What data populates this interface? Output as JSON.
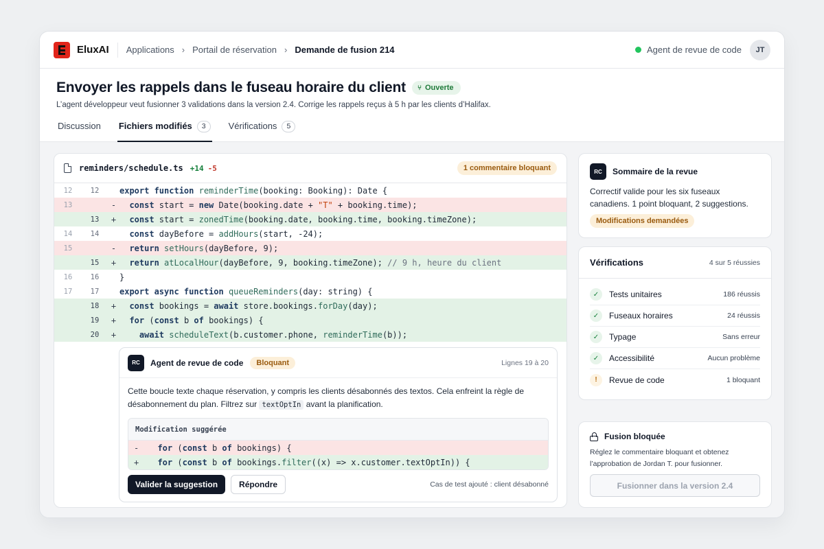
{
  "topbar": {
    "brand": "EluxAI",
    "breadcrumbs": [
      "Applications",
      "Portail de réservation",
      "Demande de fusion 214"
    ],
    "agent_status": "Agent de revue de code",
    "avatar_initials": "JT",
    "status_color": "#22c55e"
  },
  "header": {
    "title": "Envoyer les rappels dans le fuseau horaire du client",
    "status_badge": "Ouverte",
    "subtitle": "L’agent développeur veut fusionner 3 validations dans la version 2.4. Corrige les rappels reçus à 5 h par les clients d’Halifax.",
    "tabs": [
      {
        "label": "Discussion",
        "count": null
      },
      {
        "label": "Fichiers modifiés",
        "count": "3"
      },
      {
        "label": "Vérifications",
        "count": "5"
      }
    ]
  },
  "diff": {
    "filename": "reminders/schedule.ts",
    "additions": "+14",
    "deletions": "-5",
    "badge": "1 commentaire bloquant"
  },
  "comment": {
    "avatar": "RC",
    "author": "Agent de revue de code",
    "badge": "Bloquant",
    "lines": "Lignes 19 à 20",
    "body_1": "Cette boucle texte chaque réservation, y compris les clients désabonnés des textos. Cela enfreint la règle de désabonnement du plan. Filtrez sur ",
    "body_code": "textOptIn",
    "body_2": " avant la planification.",
    "suggestion_title": "Modification suggérée",
    "accept_label": "Valider la suggestion",
    "reply_label": "Répondre",
    "test_note": "Cas de test ajouté : client désabonné"
  },
  "summary": {
    "avatar": "RC",
    "title": "Sommaire de la revue",
    "text": "Correctif valide pour les six fuseaux canadiens. 1 point bloquant, 2 suggestions.",
    "badge": "Modifications demandées"
  },
  "checks": {
    "title": "Vérifications",
    "summary": "4 sur 5 réussies",
    "items": [
      {
        "label": "Tests unitaires",
        "result": "186 réussis",
        "icon": "check-icon"
      },
      {
        "label": "Fuseaux horaires",
        "result": "24 réussis",
        "icon": "check-icon"
      },
      {
        "label": "Typage",
        "result": "Sans erreur",
        "icon": "check-icon"
      },
      {
        "label": "Accessibilité",
        "result": "Aucun problème",
        "icon": "check-icon"
      },
      {
        "label": "Revue de code",
        "result": "1 bloquant",
        "icon": "warning-icon"
      }
    ]
  },
  "fusion": {
    "title": "Fusion bloquée",
    "text": "Réglez le commentaire bloquant et obtenez l’approbation de Jordan T. pour fusionner.",
    "button": "Fusionner dans la version 2.4"
  }
}
